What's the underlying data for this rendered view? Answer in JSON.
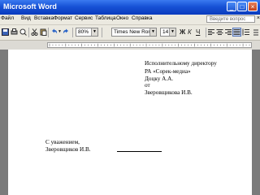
{
  "window": {
    "title": "Microsoft Word",
    "minimize": "_",
    "maximize": "□",
    "close": "×"
  },
  "menu": {
    "items": [
      "Файл",
      "Вид",
      "Вставка",
      "Формат",
      "Сервис",
      "Таблица",
      "Окно",
      "Справка"
    ],
    "help_placeholder": "Введите вопрос",
    "close_doc": "×"
  },
  "toolbar": {
    "zoom": "80%",
    "font": "Times New Roman",
    "size": "14",
    "bold": "Ж",
    "italic": "К",
    "underline": "Ч"
  },
  "document": {
    "addressee": [
      "Исполнительному директору",
      "РА «Сорек-медиа»",
      "Доцку А.А.",
      "от",
      "Зверовщикова И.В."
    ],
    "closing": "С уважением,",
    "signature": "Зверовщиков И.В."
  }
}
